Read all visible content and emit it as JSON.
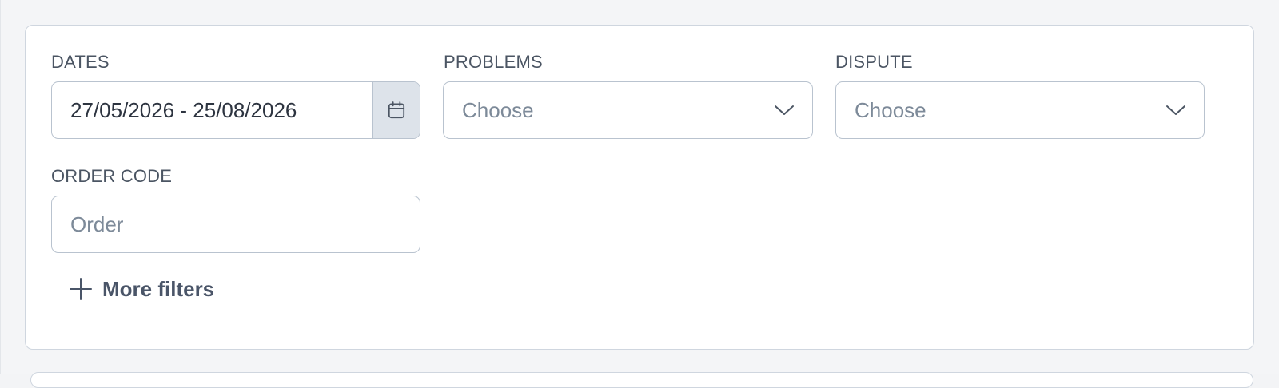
{
  "filters": {
    "dates": {
      "label": "DATES",
      "value": "27/05/2026 - 25/08/2026",
      "icon": "calendar-icon"
    },
    "problems": {
      "label": "PROBLEMS",
      "placeholder": "Choose",
      "icon": "chevron-down-icon"
    },
    "dispute": {
      "label": "DISPUTE",
      "placeholder": "Choose",
      "icon": "chevron-down-icon"
    },
    "order_code": {
      "label": "ORDER CODE",
      "placeholder": "Order"
    },
    "more_filters": {
      "label": "More filters",
      "icon": "plus-icon"
    }
  },
  "colors": {
    "border": "#b9c3cf",
    "label": "#4b5563",
    "placeholder": "#7d8a99",
    "value": "#2d3440",
    "calendar_button_bg": "#dde3ea"
  }
}
